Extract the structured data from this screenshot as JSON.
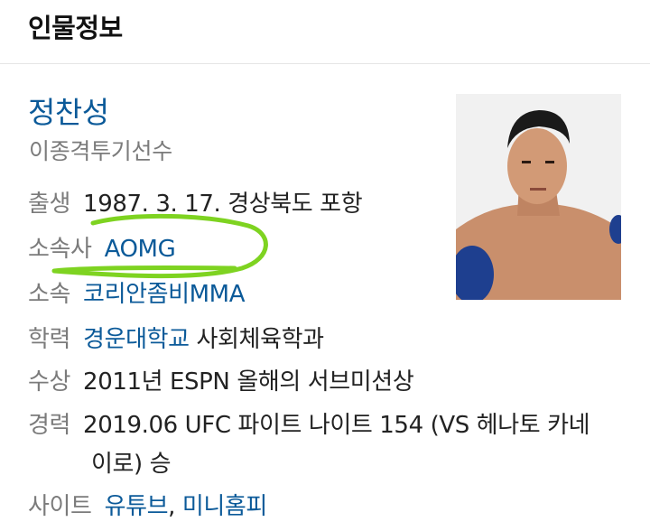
{
  "header": {
    "title": "인물정보"
  },
  "person": {
    "name": "정찬성",
    "role": "이종격투기선수",
    "photo_alt": "profile-photo"
  },
  "info": {
    "birth": {
      "label": "출생",
      "value": "1987. 3. 17. 경상북도 포항"
    },
    "agency": {
      "label": "소속사",
      "value": "AOMG"
    },
    "team": {
      "label": "소속",
      "value": "코리안좀비MMA"
    },
    "education": {
      "label": "학력",
      "school": "경운대학교",
      "major": " 사회체육학과"
    },
    "award": {
      "label": "수상",
      "value": "2011년 ESPN 올해의 서브미션상"
    },
    "career": {
      "label": "경력",
      "line1": "2019.06 UFC 파이트 나이트 154 (VS 헤나토 카네",
      "line2": "이로) 승"
    },
    "site": {
      "label": "사이트",
      "link1": "유튜브",
      "separator": ", ",
      "link2": "미니홈피"
    }
  },
  "colors": {
    "link": "#0b5a99",
    "label": "#7b7b7b",
    "highlight": "#7ed321"
  }
}
